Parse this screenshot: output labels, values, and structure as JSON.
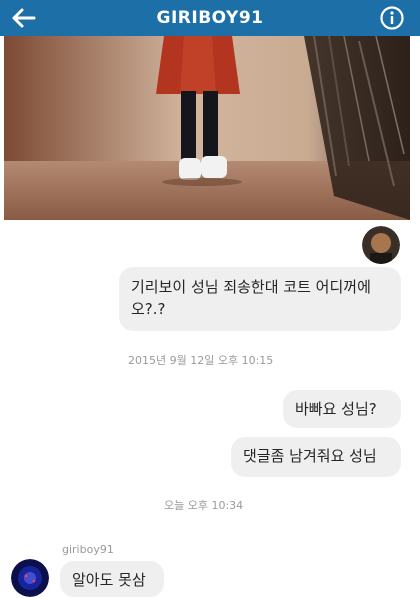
{
  "header": {
    "title": "GIRIBOY91",
    "background_color": "#1d6fa8",
    "back_icon": "arrow-left-icon",
    "info_icon": "info-circle-icon"
  },
  "messages": [
    {
      "from": "me",
      "text": "기리보이 성님 죄송한대 코트 어디꺼에오?.?"
    },
    {
      "from": "me",
      "text": "바빠요 성님?"
    },
    {
      "from": "me",
      "text": "댓글좀 남겨줘요 성님"
    },
    {
      "from": "them",
      "sender": "giriboy91",
      "text": "알아도 못삼"
    }
  ],
  "timestamps": [
    "2015년 9월 12일 오후 10:15",
    "오늘 오후 10:34"
  ],
  "bubble_color": "#efefef"
}
